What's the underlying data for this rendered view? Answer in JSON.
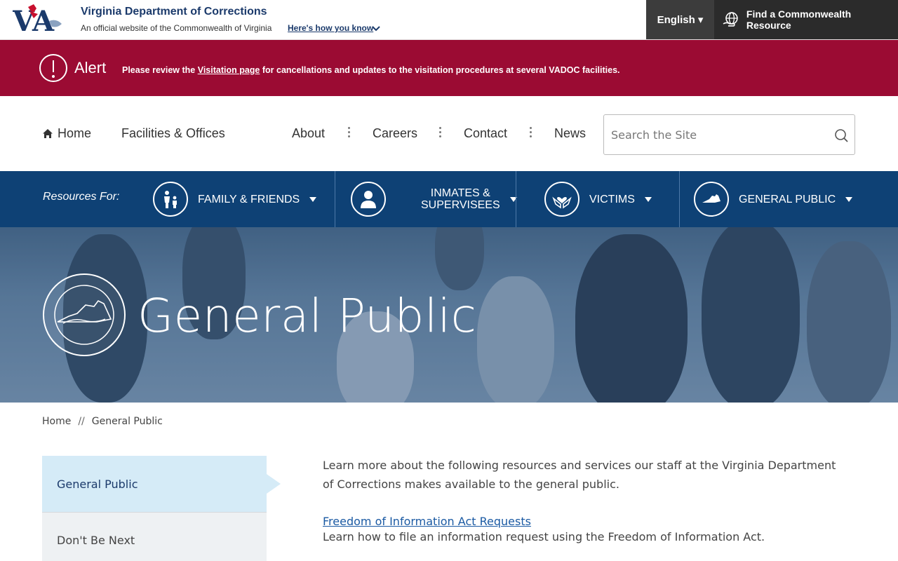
{
  "topbar": {
    "agency_name": "Virginia Department of Corrections",
    "official_text": "An official website of the Commonwealth of Virginia",
    "how_you_know": "Here's how you know",
    "language": "English",
    "language_caret": "▾",
    "resource_label": "Find a Commonwealth Resource"
  },
  "alert": {
    "title": "Alert",
    "text_before": "Please review the ",
    "link_text": "Visitation page",
    "text_after": " for cancellations and updates to the visitation procedures at several VADOC facilities.",
    "color": "#9b0b33"
  },
  "nav": {
    "home": "Home",
    "facilities": "Facilities & Offices",
    "about": "About",
    "careers": "Careers",
    "contact": "Contact",
    "news": "News",
    "search_placeholder": "Search the Site"
  },
  "resources": {
    "label": "Resources For:",
    "items": [
      {
        "label": "Family & Friends",
        "icon": "family-icon"
      },
      {
        "label_line1": "Inmates &",
        "label_line2": "Supervisees",
        "icon": "person-icon"
      },
      {
        "label": "Victims",
        "icon": "heart-hands-icon"
      },
      {
        "label": "General Public",
        "icon": "virginia-map-icon"
      }
    ],
    "color": "#0e4175"
  },
  "hero": {
    "title": "General Public"
  },
  "breadcrumb": {
    "home": "Home",
    "separator": "//",
    "current": "General Public"
  },
  "sidenav": {
    "items": [
      {
        "label": "General Public",
        "active": true
      },
      {
        "label": "Don't Be Next",
        "active": false
      }
    ]
  },
  "content": {
    "intro": "Learn more about the following resources and services our staff at the Virginia Department of Corrections makes available to the general public.",
    "foia_link": "Freedom of Information Act Requests",
    "foia_desc": "Learn how to file an information request using the Freedom of Information Act."
  }
}
